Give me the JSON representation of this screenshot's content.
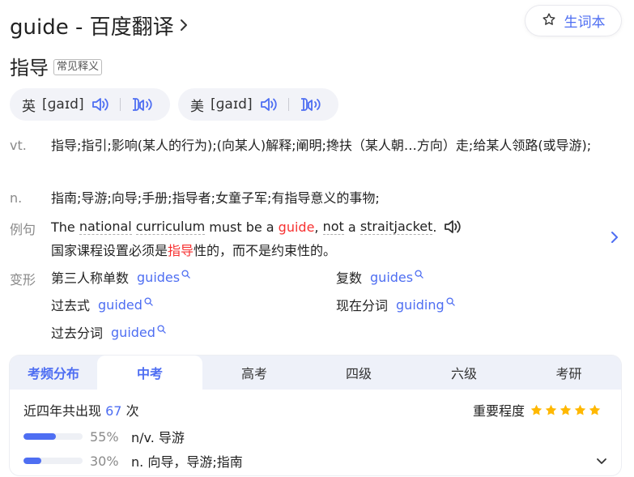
{
  "header": {
    "title": "guide - 百度翻译",
    "chevron_icon": "chevron-right-icon",
    "vocab_button": {
      "icon": "star-outline-icon",
      "label": "生词本"
    }
  },
  "word": {
    "text": "指导",
    "badge": "常见释义"
  },
  "pronunciations": [
    {
      "label": "英",
      "ipa": "[ɡaɪd]",
      "speaker_icon": "speaker-icon",
      "record_icon": "record-icon"
    },
    {
      "label": "美",
      "ipa": "[ɡaɪd]",
      "speaker_icon": "speaker-icon",
      "record_icon": "record-icon"
    }
  ],
  "definitions": [
    {
      "pos": "vt.",
      "text": "指导;指引;影响(某人的行为);(向某人)解释;阐明;搀扶（某人朝…方向）走;给某人领路(或导游);"
    },
    {
      "pos": "n.",
      "text": "指南;导游;向导;手册;指导者;女童子军;有指导意义的事物;"
    }
  ],
  "example": {
    "label": "例句",
    "en": {
      "w1": "The",
      "w2": "national",
      "w3": "curriculum",
      "w4": "must be a",
      "w5": "guide",
      "w6": ",",
      "w7": "not",
      "w8": "a",
      "w9": "straitjacket",
      "w10": "."
    },
    "zh": {
      "before": "国家课程设置必须是",
      "hl": "指导",
      "after": "性的，而不是约束性的。"
    }
  },
  "forms": {
    "label": "变形",
    "items": [
      {
        "k": "第三人称单数",
        "v": "guides"
      },
      {
        "k": "复数",
        "v": "guides"
      },
      {
        "k": "过去式",
        "v": "guided"
      },
      {
        "k": "现在分词",
        "v": "guiding"
      },
      {
        "k": "过去分词",
        "v": "guided"
      }
    ]
  },
  "exam": {
    "tabs": [
      "考频分布",
      "中考",
      "高考",
      "四级",
      "六级",
      "考研"
    ],
    "active_tab": "中考",
    "stat": {
      "prefix": "近四年共出现",
      "count": "67",
      "suffix": "次"
    },
    "importance_label": "重要程度",
    "importance_stars": 5,
    "rows": [
      {
        "pct": "55%",
        "fraction": 0.55,
        "meaning": "n/v. 导游"
      },
      {
        "pct": "30%",
        "fraction": 0.3,
        "meaning": "n. 向导，导游;指南"
      }
    ]
  },
  "colors": {
    "accent": "#4e6ef2",
    "highlight": "#f73131",
    "star": "#ffb800",
    "pill_bg": "#f2f3f8",
    "tabs_bg": "#eef1f9"
  }
}
